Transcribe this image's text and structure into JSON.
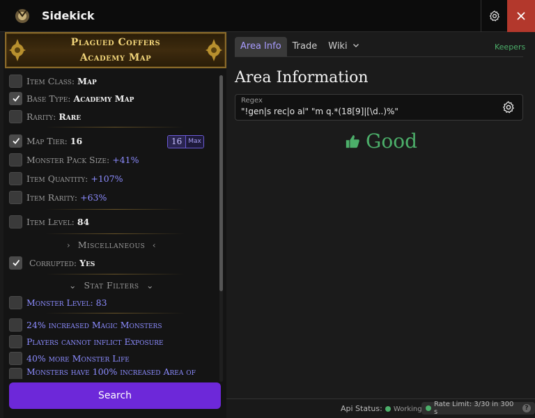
{
  "app": {
    "title": "Sidekick"
  },
  "item": {
    "name_line1": "Plagued Coffers",
    "name_line2": "Academy Map"
  },
  "properties": {
    "item_class": {
      "label": "Item Class:",
      "value": "Map",
      "checked": false
    },
    "base_type": {
      "label": "Base Type:",
      "value": "Academy Map",
      "checked": true
    },
    "rarity": {
      "label": "Rarity:",
      "value": "Rare",
      "checked": false
    },
    "map_tier": {
      "label": "Map Tier:",
      "value": "16",
      "checked": true,
      "badge_value": "16",
      "badge_max": "Max"
    },
    "monster_pack_size": {
      "label": "Monster Pack Size:",
      "value": "+41%",
      "checked": false
    },
    "item_quantity": {
      "label": "Item Quantity:",
      "value": "+107%",
      "checked": false
    },
    "item_rarity": {
      "label": "Item Rarity:",
      "value": "+63%",
      "checked": false
    },
    "item_level": {
      "label": "Item Level:",
      "value": "84",
      "checked": false
    },
    "corrupted": {
      "label": "Corrupted:",
      "value": "Yes",
      "checked": true
    }
  },
  "sections": {
    "miscellaneous": "Miscellaneous",
    "stat_filters": "Stat Filters"
  },
  "stat_filters": {
    "monster_level": {
      "label": "Monster Level:",
      "value": "83",
      "checked": false
    },
    "mods": [
      "24% increased Magic Monsters",
      "Players cannot inflict Exposure",
      "40% more Monster Life",
      "Monsters have 100% increased Area of"
    ]
  },
  "search_button": "Search",
  "tabs": [
    "Area Info",
    "Trade",
    "Wiki"
  ],
  "active_tab": "Area Info",
  "keepers_link": "Keepers",
  "area": {
    "title": "Area Information",
    "regex_label": "Regex",
    "regex_value": "\"!gen|s rec|o al\" \"m q.*(18[9]|[\\d..)%\"",
    "verdict": "Good"
  },
  "status": {
    "api_label": "Api Status:",
    "api_value": "Working",
    "rate_limit": "Rate Limit: 3/30 in 300 s"
  },
  "colors": {
    "accent": "#6d28d9",
    "good": "#4caf6a",
    "mod_blue": "#8c8cff",
    "close_red": "#b3382c",
    "unique_gold": "#f2d57a"
  }
}
